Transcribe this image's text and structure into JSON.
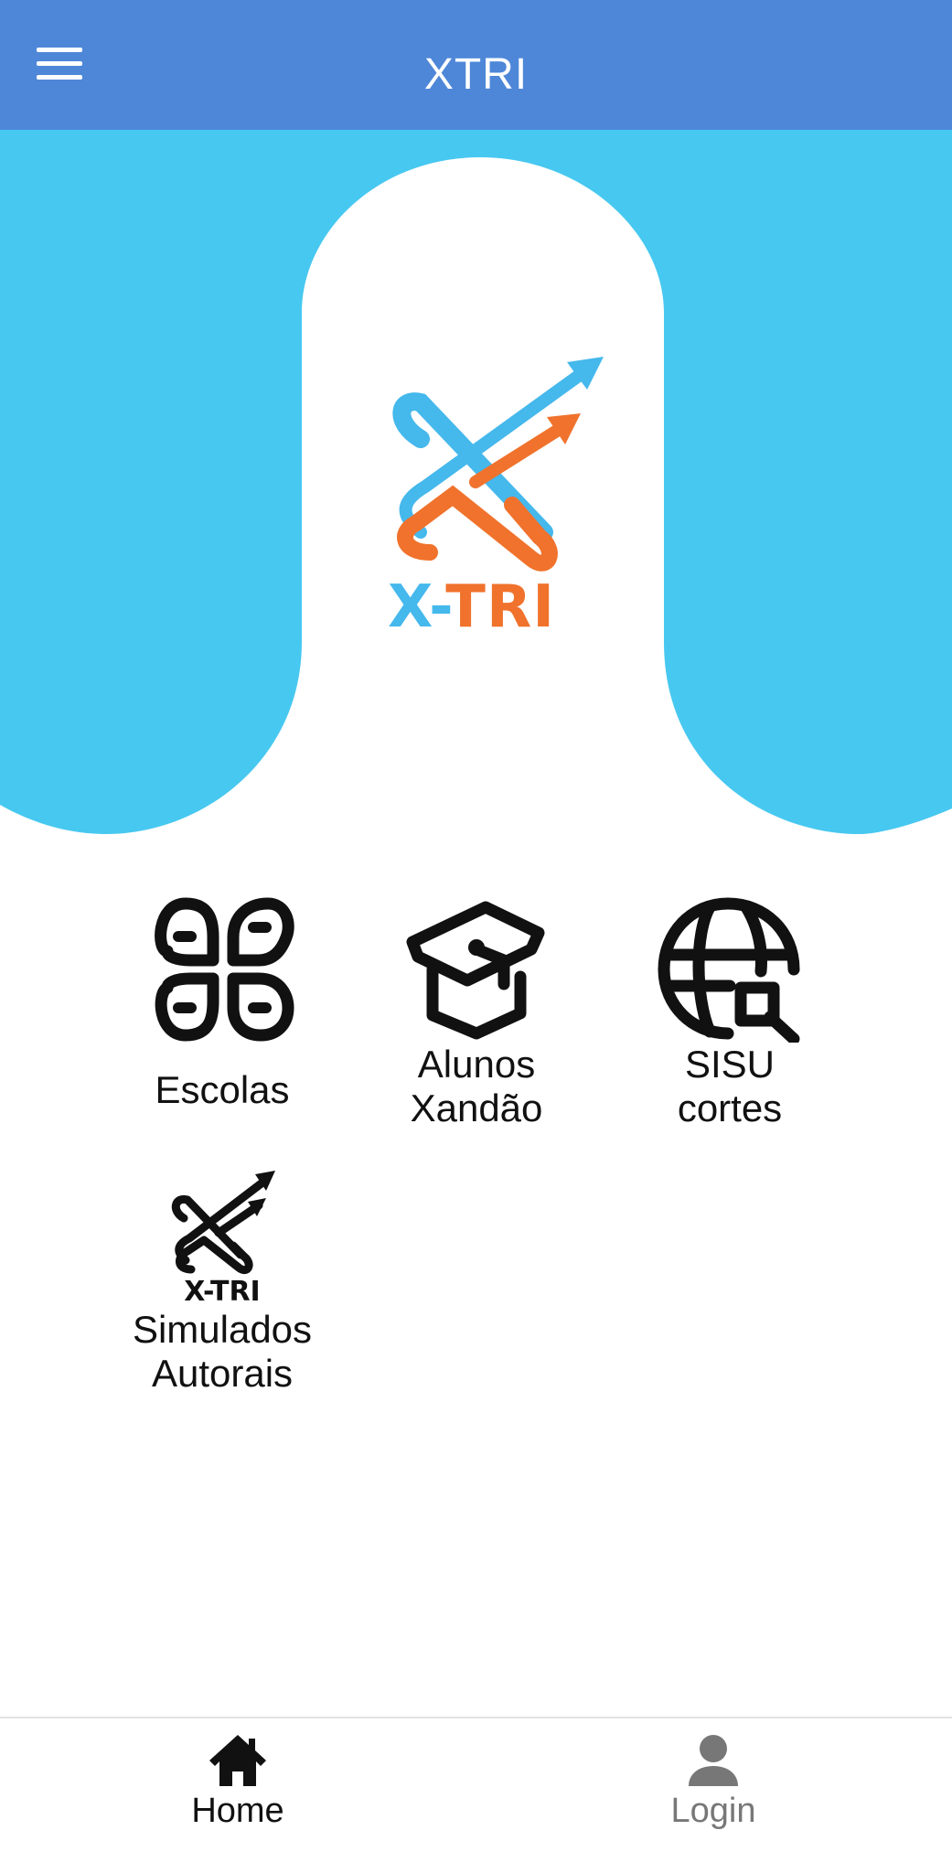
{
  "header": {
    "title": "XTRI",
    "menu_icon": "hamburger-menu-icon",
    "background": "#4e87d8"
  },
  "hero": {
    "logo_text": "X-TRI",
    "colors": {
      "sky": "#47c8f0",
      "logo_blue": "#45b8ec",
      "logo_orange": "#f0722c"
    }
  },
  "tiles": [
    {
      "label": "Escolas",
      "icon": "apps-grid-icon"
    },
    {
      "label": "Alunos\nXandão",
      "icon": "graduation-cap-icon"
    },
    {
      "label": "SISU\ncortes",
      "icon": "globe-search-icon"
    },
    {
      "label": "Simulados\nAutorais",
      "icon": "xtri-logo-icon",
      "icon_text": "X-TRI"
    }
  ],
  "tab_bar": {
    "tabs": [
      {
        "label": "Home",
        "icon": "home-icon",
        "active": true,
        "color": "#111111"
      },
      {
        "label": "Login",
        "icon": "person-icon",
        "active": false,
        "color": "#777777"
      }
    ]
  }
}
